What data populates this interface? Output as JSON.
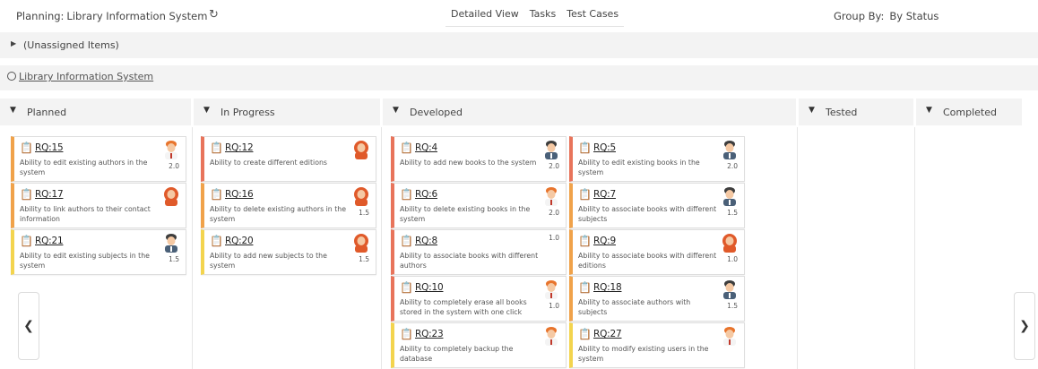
{
  "toolbar": {
    "planning_label": "Planning:",
    "release_name": "Library Information System",
    "refresh_icon": "refresh-icon",
    "views": [
      "Detailed View",
      "Tasks",
      "Test Cases"
    ],
    "group_by_label": "Group By:",
    "group_by_value": "By Status"
  },
  "unassigned": {
    "label": "(Unassigned Items)"
  },
  "release": {
    "label": "Library Information System"
  },
  "columns": [
    {
      "title": "Planned"
    },
    {
      "title": "In Progress"
    },
    {
      "title": "Developed"
    },
    {
      "title": "Tested"
    },
    {
      "title": "Completed"
    }
  ],
  "cards": [
    {
      "id": "RQ:15",
      "desc": "Ability to edit existing authors in the system",
      "est": "2.0",
      "color": "#f0a24a",
      "avatar": "orange-hair-man"
    },
    {
      "id": "RQ:17",
      "desc": "Ability to link authors to their contact information",
      "est": "",
      "color": "#f0a24a",
      "avatar": "red-hair-woman"
    },
    {
      "id": "RQ:21",
      "desc": "Ability to edit existing subjects in the system",
      "est": "1.5",
      "color": "#f3d44e",
      "avatar": "dark-hair-man"
    },
    {
      "id": "RQ:12",
      "desc": "Ability to create different editions",
      "est": "",
      "color": "#e8745b",
      "avatar": "red-hair-woman"
    },
    {
      "id": "RQ:16",
      "desc": "Ability to delete existing authors in the system",
      "est": "1.5",
      "color": "#f0a24a",
      "avatar": "red-hair-woman"
    },
    {
      "id": "RQ:20",
      "desc": "Ability to add new subjects to the system",
      "est": "1.5",
      "color": "#f3d44e",
      "avatar": "red-hair-woman"
    },
    {
      "id": "RQ:4",
      "desc": "Ability to add new books to the system",
      "est": "2.0",
      "color": "#e8745b",
      "avatar": "dark-hair-man"
    },
    {
      "id": "RQ:5",
      "desc": "Ability to edit existing books in the system",
      "est": "2.0",
      "color": "#e8745b",
      "avatar": "dark-hair-man"
    },
    {
      "id": "RQ:6",
      "desc": "Ability to delete existing books in the system",
      "est": "2.0",
      "color": "#e8745b",
      "avatar": "orange-hair-man"
    },
    {
      "id": "RQ:7",
      "desc": "Ability to associate books with different subjects",
      "est": "1.5",
      "color": "#f0a24a",
      "avatar": "dark-hair-man"
    },
    {
      "id": "RQ:8",
      "desc": "Ability to associate books with different authors",
      "est": "1.0",
      "color": "#e8745b",
      "avatar": ""
    },
    {
      "id": "RQ:9",
      "desc": "Ability to associate books with different editions",
      "est": "1.0",
      "color": "#f0a24a",
      "avatar": "red-hair-woman"
    },
    {
      "id": "RQ:10",
      "desc": "Ability to completely erase all books stored in the system with one click",
      "est": "1.0",
      "color": "#e8745b",
      "avatar": "orange-hair-man"
    },
    {
      "id": "RQ:18",
      "desc": "Ability to associate authors with subjects",
      "est": "1.5",
      "color": "#f0a24a",
      "avatar": "dark-hair-man"
    },
    {
      "id": "RQ:23",
      "desc": "Ability to completely backup the database",
      "est": "",
      "color": "#f3d44e",
      "avatar": "orange-hair-man"
    },
    {
      "id": "RQ:27",
      "desc": "Ability to modify existing users in the system",
      "est": "",
      "color": "#f3d44e",
      "avatar": "orange-hair-man"
    }
  ],
  "nav": {
    "prev_icon": "chevron-left-icon",
    "next_icon": "chevron-right-icon"
  }
}
